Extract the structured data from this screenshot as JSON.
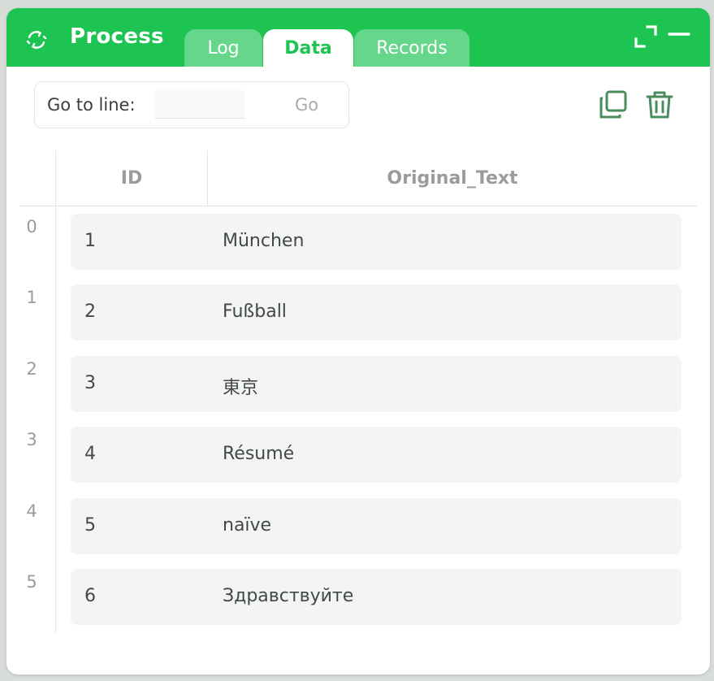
{
  "window": {
    "title": "Process",
    "tabs": [
      {
        "label": "Log"
      },
      {
        "label": "Data"
      },
      {
        "label": "Records"
      }
    ],
    "active_tab": "Data"
  },
  "toolbar": {
    "goto_label": "Go to line:",
    "goto_value": "",
    "go_label": "Go"
  },
  "table": {
    "columns": [
      "ID",
      "Original_Text"
    ],
    "rows": [
      {
        "index": "0",
        "id": "1",
        "text": "München"
      },
      {
        "index": "1",
        "id": "2",
        "text": "Fußball"
      },
      {
        "index": "2",
        "id": "3",
        "text": "東京"
      },
      {
        "index": "3",
        "id": "4",
        "text": "Résumé"
      },
      {
        "index": "4",
        "id": "5",
        "text": "naïve"
      },
      {
        "index": "5",
        "id": "6",
        "text": "Здравствуйте"
      }
    ]
  },
  "icons": {
    "app": "sync-icon",
    "expand": "expand-icon",
    "minimize": "minimize-icon",
    "copy": "copy-icon",
    "delete": "trash-icon"
  },
  "colors": {
    "accent": "#1dc452",
    "tab_inactive": "#66d68a",
    "icon_green": "#4a8c5c",
    "row_bg": "#f2f5f2"
  }
}
